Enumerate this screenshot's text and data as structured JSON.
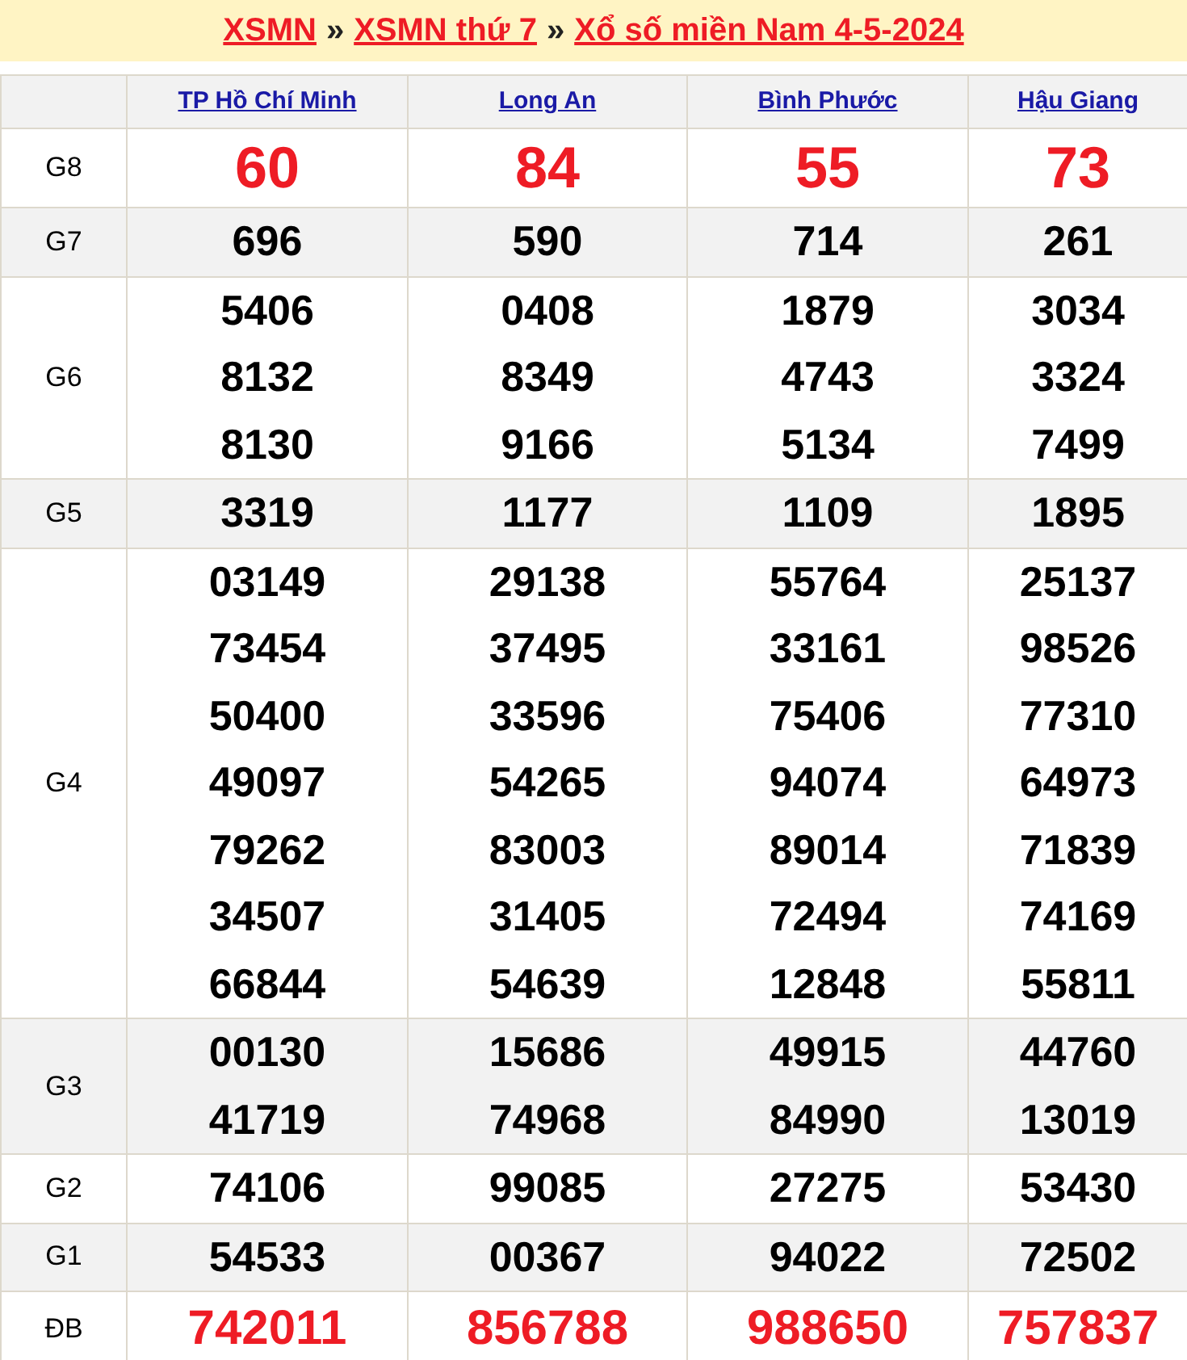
{
  "breadcrumb": [
    {
      "kind": "link",
      "text": "XSMN"
    },
    {
      "kind": "separator",
      "text": "»"
    },
    {
      "kind": "link",
      "text": "XSMN thứ 7"
    },
    {
      "kind": "separator",
      "text": "»"
    },
    {
      "kind": "link",
      "text": "Xổ số miền Nam 4-5-2024"
    }
  ],
  "provinces": [
    "TP Hồ Chí Minh",
    "Long An",
    "Bình Phước",
    "Hậu Giang"
  ],
  "prizes": [
    {
      "label": "G8",
      "kind": "top",
      "shaded": false,
      "results": [
        [
          "60"
        ],
        [
          "84"
        ],
        [
          "55"
        ],
        [
          "73"
        ]
      ]
    },
    {
      "label": "G7",
      "kind": "plain",
      "shaded": true,
      "results": [
        [
          "696"
        ],
        [
          "590"
        ],
        [
          "714"
        ],
        [
          "261"
        ]
      ]
    },
    {
      "label": "G6",
      "kind": "plain",
      "shaded": false,
      "results": [
        [
          "5406",
          "8132",
          "8130"
        ],
        [
          "0408",
          "8349",
          "9166"
        ],
        [
          "1879",
          "4743",
          "5134"
        ],
        [
          "3034",
          "3324",
          "7499"
        ]
      ]
    },
    {
      "label": "G5",
      "kind": "plain",
      "shaded": true,
      "results": [
        [
          "3319"
        ],
        [
          "1177"
        ],
        [
          "1109"
        ],
        [
          "1895"
        ]
      ]
    },
    {
      "label": "G4",
      "kind": "plain",
      "shaded": false,
      "results": [
        [
          "03149",
          "73454",
          "50400",
          "49097",
          "79262",
          "34507",
          "66844"
        ],
        [
          "29138",
          "37495",
          "33596",
          "54265",
          "83003",
          "31405",
          "54639"
        ],
        [
          "55764",
          "33161",
          "75406",
          "94074",
          "89014",
          "72494",
          "12848"
        ],
        [
          "25137",
          "98526",
          "77310",
          "64973",
          "71839",
          "74169",
          "55811"
        ]
      ]
    },
    {
      "label": "G3",
      "kind": "plain",
      "shaded": true,
      "results": [
        [
          "00130",
          "41719"
        ],
        [
          "15686",
          "74968"
        ],
        [
          "49915",
          "84990"
        ],
        [
          "44760",
          "13019"
        ]
      ]
    },
    {
      "label": "G2",
      "kind": "plain",
      "shaded": false,
      "results": [
        [
          "74106"
        ],
        [
          "99085"
        ],
        [
          "27275"
        ],
        [
          "53430"
        ]
      ]
    },
    {
      "label": "G1",
      "kind": "plain",
      "shaded": true,
      "results": [
        [
          "54533"
        ],
        [
          "00367"
        ],
        [
          "94022"
        ],
        [
          "72502"
        ]
      ]
    },
    {
      "label": "ĐB",
      "kind": "jackpot",
      "shaded": false,
      "results": [
        [
          "742011"
        ],
        [
          "856788"
        ],
        [
          "988650"
        ],
        [
          "757837"
        ]
      ]
    }
  ]
}
